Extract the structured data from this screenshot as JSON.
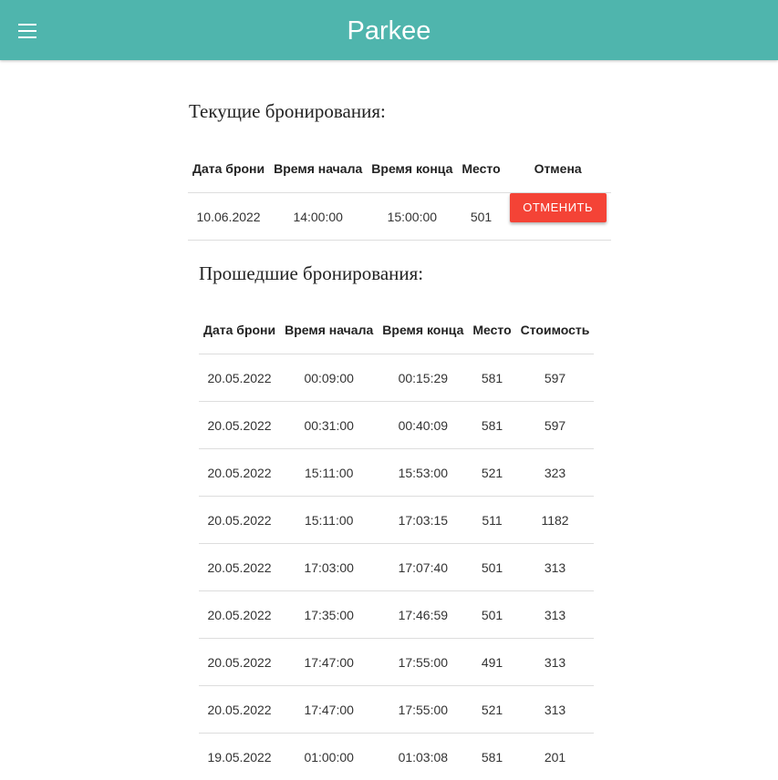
{
  "header": {
    "title": "Parkee",
    "background_color": "#4fb5ad",
    "menu_icon": "hamburger-menu-icon"
  },
  "current": {
    "title": "Текущие бронирования:",
    "columns": [
      "Дата брони",
      "Время начала",
      "Время конца",
      "Место",
      "Отмена"
    ],
    "rows": [
      {
        "date": "10.06.2022",
        "start": "14:00:00",
        "end": "15:00:00",
        "place": "501",
        "action_label": "ОТМЕНИТЬ"
      }
    ],
    "action_color": "#f44336"
  },
  "past": {
    "title": "Прошедшие бронирования:",
    "columns": [
      "Дата брони",
      "Время начала",
      "Время конца",
      "Место",
      "Стоимость"
    ],
    "rows": [
      {
        "date": "20.05.2022",
        "start": "00:09:00",
        "end": "00:15:29",
        "place": "581",
        "cost": "597"
      },
      {
        "date": "20.05.2022",
        "start": "00:31:00",
        "end": "00:40:09",
        "place": "581",
        "cost": "597"
      },
      {
        "date": "20.05.2022",
        "start": "15:11:00",
        "end": "15:53:00",
        "place": "521",
        "cost": "323"
      },
      {
        "date": "20.05.2022",
        "start": "15:11:00",
        "end": "17:03:15",
        "place": "511",
        "cost": "1182"
      },
      {
        "date": "20.05.2022",
        "start": "17:03:00",
        "end": "17:07:40",
        "place": "501",
        "cost": "313"
      },
      {
        "date": "20.05.2022",
        "start": "17:35:00",
        "end": "17:46:59",
        "place": "501",
        "cost": "313"
      },
      {
        "date": "20.05.2022",
        "start": "17:47:00",
        "end": "17:55:00",
        "place": "491",
        "cost": "313"
      },
      {
        "date": "20.05.2022",
        "start": "17:47:00",
        "end": "17:55:00",
        "place": "521",
        "cost": "313"
      },
      {
        "date": "19.05.2022",
        "start": "01:00:00",
        "end": "01:03:08",
        "place": "581",
        "cost": "201"
      }
    ]
  }
}
